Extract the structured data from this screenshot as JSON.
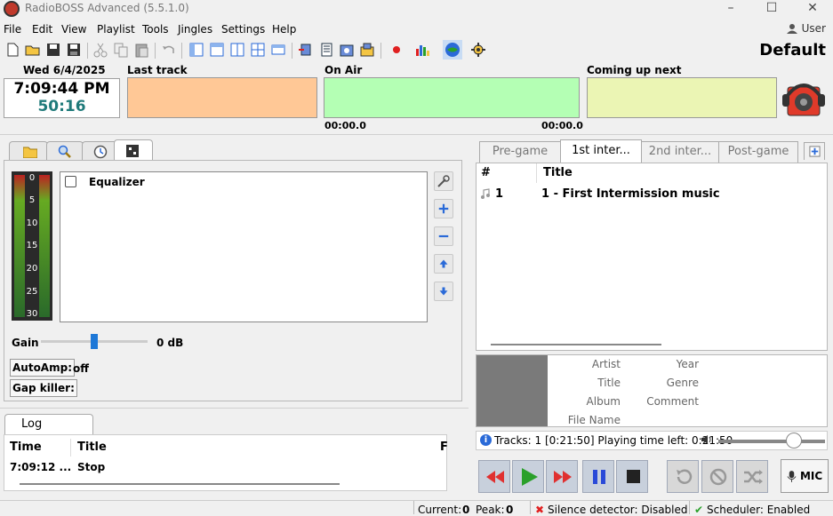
{
  "window": {
    "title": "RadioBOSS Advanced (5.5.1.0)",
    "controls": [
      "–",
      "☐",
      "✕"
    ],
    "user": "User",
    "profile": "Default"
  },
  "menu": [
    "File",
    "Edit",
    "View",
    "Playlist",
    "Tools",
    "Jingles",
    "Settings",
    "Help"
  ],
  "toolbar_icons": [
    "new-icon",
    "open-icon",
    "save-icon",
    "save-all-icon",
    "cut-icon",
    "copy-icon",
    "paste-icon",
    "undo-icon",
    "layout1-icon",
    "layout2-icon",
    "layout3-icon",
    "layout4-icon",
    "layout5-icon",
    "insert-icon",
    "playlist-gen-icon",
    "scheduler-icon",
    "jingles-icon",
    "record-icon",
    "stats-icon",
    "broadcast-icon",
    "settings-icon"
  ],
  "top": {
    "date": "Wed 6/4/2025",
    "time": "7:09:44 PM",
    "countdown": "50:16",
    "last_track_label": "Last track",
    "on_air_label": "On Air",
    "coming_next_label": "Coming up next",
    "on_air_elapsed": "00:00.0",
    "on_air_remaining": "00:00.0"
  },
  "colors": {
    "last_track": "#ffc896",
    "on_air": "#b4ffb4",
    "coming_next": "#ebf5b4",
    "countdown": "#1f7a7a"
  },
  "left_tabs": [
    "folder-icon",
    "search-icon",
    "clock-icon",
    "effects-icon"
  ],
  "effects": {
    "vu_labels": [
      "0",
      "5",
      "10",
      "15",
      "20",
      "25",
      "30"
    ],
    "equalizer_label": "Equalizer",
    "gain_label": "Gain",
    "gain_value": "0 dB",
    "autoamp_label": "AutoAmp:",
    "autoamp_state": "off",
    "gapkiller_label": "Gap killer:"
  },
  "log": {
    "tab": "Log",
    "headers": [
      "Time",
      "Title",
      "F"
    ],
    "rows": [
      {
        "time": "7:09:12 ...",
        "title": "Stop"
      }
    ]
  },
  "playlist": {
    "tabs": [
      "Pre-game",
      "1st inter...",
      "2nd inter...",
      "Post-game"
    ],
    "active_tab": 1,
    "headers": [
      "#",
      "Title"
    ],
    "rows": [
      {
        "num": "1",
        "title": "1 - First Intermission music"
      }
    ]
  },
  "track_info": {
    "labels_left": [
      "Artist",
      "Title",
      "Album",
      "File Name"
    ],
    "labels_right": [
      "Year",
      "Genre",
      "Comment"
    ]
  },
  "status": {
    "text": "Tracks: 1 [0:21:50] Playing time left: 0:21:50"
  },
  "player": {
    "mic_label": "MIC"
  },
  "statusbar": {
    "current_label": "Current:",
    "current_value": "0",
    "peak_label": "Peak:",
    "peak_value": "0",
    "silence": "Silence detector: Disabled",
    "scheduler": "Scheduler: Enabled"
  }
}
